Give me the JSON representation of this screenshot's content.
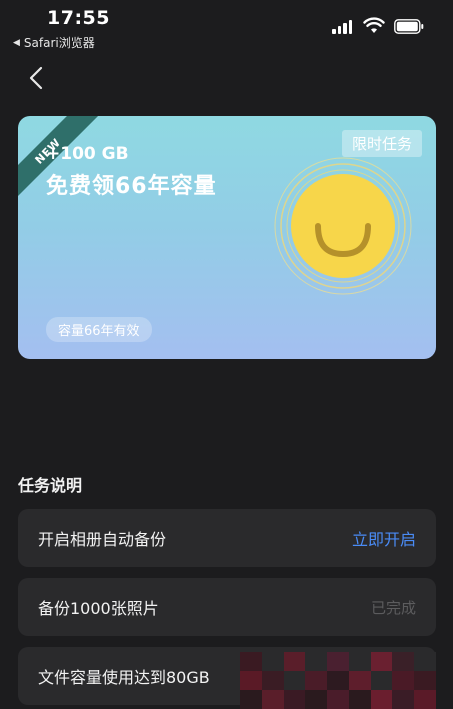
{
  "status_bar": {
    "time": "17:55",
    "back_app": "Safari浏览器"
  },
  "card": {
    "ribbon": "NEW",
    "amount": "+100 GB",
    "title": "免费领66年容量",
    "limited_badge": "限时任务",
    "validity": "容量66年有效"
  },
  "tasks": {
    "section_title": "任务说明",
    "items": [
      {
        "label": "开启相册自动备份",
        "action": "立即开启"
      },
      {
        "label": "备份1000张照片",
        "status": "已完成"
      },
      {
        "label": "文件容量使用达到80GB"
      }
    ]
  },
  "colors": {
    "background": "#1c1c1e",
    "row_background": "#2a2a2c",
    "accent_blue": "#4a8cf7",
    "sun_yellow": "#f7d64a"
  }
}
